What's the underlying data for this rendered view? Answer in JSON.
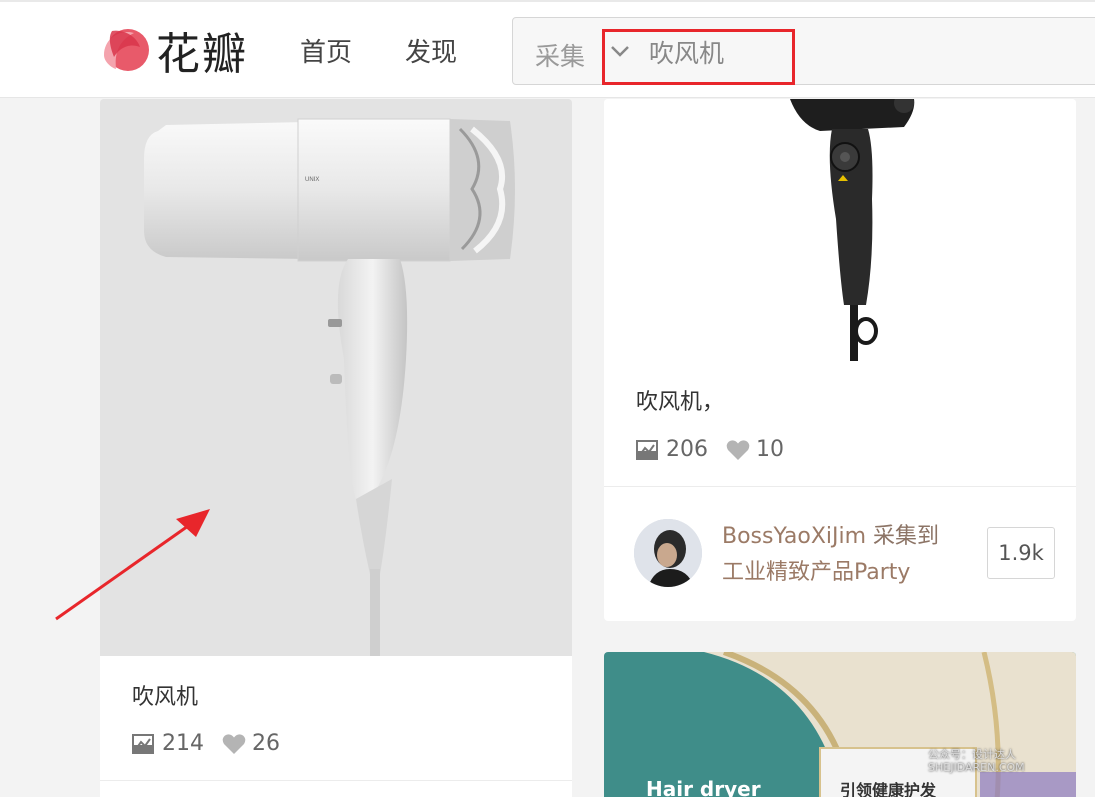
{
  "header": {
    "logo_text": "花瓣",
    "nav": {
      "home": "首页",
      "discover": "发现"
    },
    "search": {
      "scope": "采集",
      "value": "吹风机"
    }
  },
  "cards": {
    "left": {
      "caption": "吹风机",
      "repins": "214",
      "likes": "26"
    },
    "right": {
      "caption": "吹风机，",
      "repins": "206",
      "likes": "10",
      "pinner_name": "BossYaoXiJim",
      "pinner_action": "采集到",
      "board": "工业精致产品Party",
      "board_count": "1.9k"
    },
    "bottom": {
      "banner_text": "Hair dryer",
      "banner_cn": "引领健康护发"
    }
  },
  "watermark": {
    "line1": "公众号：设计达人",
    "line2": "SHEJIDAREN.COM"
  },
  "colors": {
    "accent_red": "#e8262b",
    "logo_red": "#e85a6a",
    "card_bg": "#ffffff",
    "page_bg": "#f3f3f3"
  }
}
